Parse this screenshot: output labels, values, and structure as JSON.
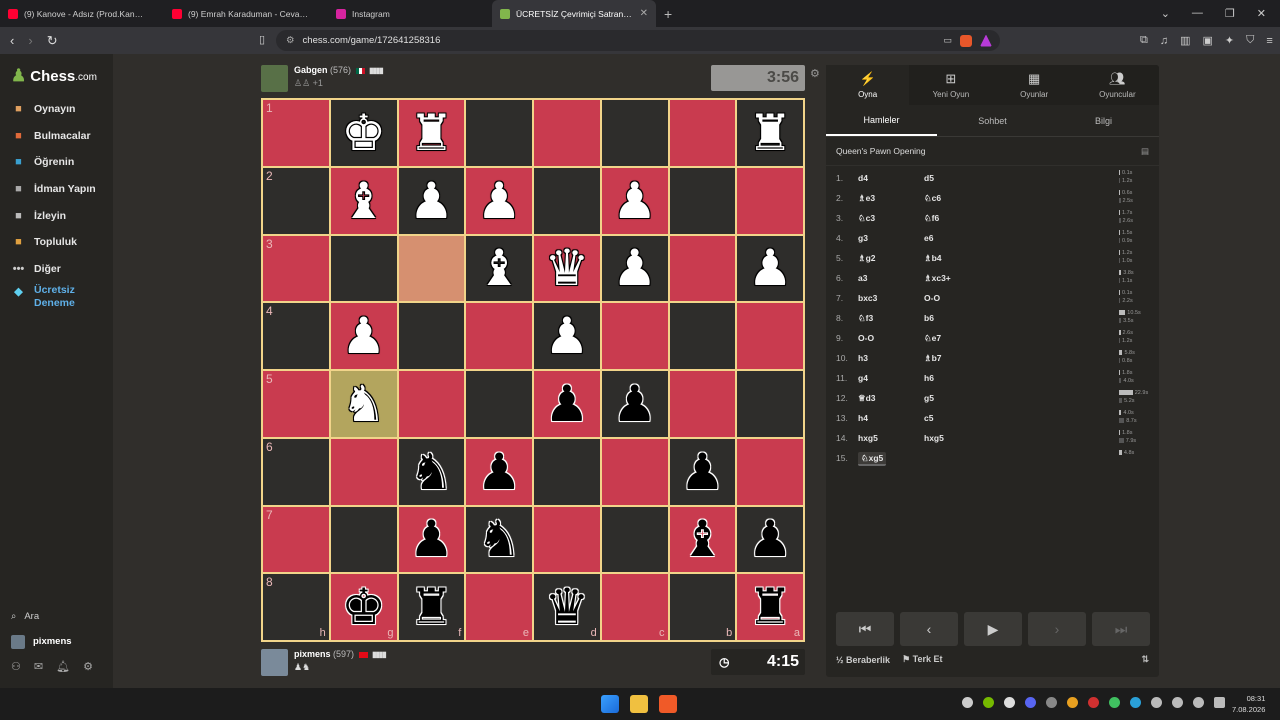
{
  "browser": {
    "tabs": [
      {
        "title": "(9) Kanove - Adsız (Prod.Kanove) - YouTube",
        "color": "#ff0033",
        "active": false
      },
      {
        "title": "(9) Emrah Karaduman - Cevapsız Çınlama",
        "color": "#ff0033",
        "active": false
      },
      {
        "title": "Instagram",
        "color": "#d6249f",
        "active": false
      },
      {
        "title": "ÜCRETSİZ Çevrimiçi Satranç Oyna",
        "color": "#81b64c",
        "active": true
      }
    ],
    "url": "chess.com/game/172641258316"
  },
  "sidebar": {
    "logo": "Chess",
    "logo_suffix": ".com",
    "items": [
      {
        "label": "Oynayın",
        "icon": "play-icon",
        "color": "#e0a060"
      },
      {
        "label": "Bulmacalar",
        "icon": "puzzle-icon",
        "color": "#e06a3a"
      },
      {
        "label": "Öğrenin",
        "icon": "learn-icon",
        "color": "#3aa0d0"
      },
      {
        "label": "İdman Yapın",
        "icon": "train-icon",
        "color": "#aaaaaa"
      },
      {
        "label": "İzleyin",
        "icon": "watch-icon",
        "color": "#bbbbbb"
      },
      {
        "label": "Topluluk",
        "icon": "community-icon",
        "color": "#e0a040"
      },
      {
        "label": "Diğer",
        "icon": "more-icon",
        "color": "#cccccc"
      }
    ],
    "trial_line1": "Ücretsiz",
    "trial_line2": "Deneme",
    "search": "Ara",
    "username": "pixmens"
  },
  "top_player": {
    "name": "Gabgen",
    "rating": "(576)",
    "captured_extra": "+1",
    "clock": "3:56"
  },
  "bottom_player": {
    "name": "pixmens",
    "rating": "(597)",
    "clock": "4:15"
  },
  "board": {
    "ranks": [
      "1",
      "2",
      "3",
      "4",
      "5",
      "6",
      "7",
      "8"
    ],
    "files": [
      "h",
      "g",
      "f",
      "e",
      "d",
      "c",
      "b",
      "a"
    ],
    "squares": [
      [
        "",
        "wK",
        "wR",
        "",
        "",
        "",
        "",
        "wR"
      ],
      [
        "",
        "wB",
        "wP",
        "wP",
        "",
        "wP",
        "",
        ""
      ],
      [
        "",
        "",
        "",
        "wB",
        "wQ",
        "wP",
        "",
        "wP"
      ],
      [
        "",
        "wP",
        "",
        "",
        "wP",
        "",
        "",
        ""
      ],
      [
        "",
        "wN",
        "",
        "",
        "bP",
        "bP",
        "",
        ""
      ],
      [
        "",
        "",
        "bN",
        "bP",
        "",
        "",
        "bP",
        ""
      ],
      [
        "",
        "",
        "bP",
        "bN",
        "",
        "",
        "bB",
        "bP"
      ],
      [
        "",
        "bK",
        "bR",
        "",
        "bQ",
        "",
        "",
        "bR"
      ]
    ]
  },
  "panel": {
    "tabs": [
      {
        "label": "Oyna",
        "icon": "bolt-icon"
      },
      {
        "label": "Yeni Oyun",
        "icon": "plus-icon"
      },
      {
        "label": "Oyunlar",
        "icon": "board-icon"
      },
      {
        "label": "Oyuncular",
        "icon": "players-icon"
      }
    ],
    "subtabs": [
      "Hamleler",
      "Sohbet",
      "Bilgi"
    ],
    "opening": "Queen's Pawn Opening",
    "moves": [
      {
        "n": "1.",
        "w": "d4",
        "b": "d5",
        "tw": "0.1s",
        "tb": "1.2s"
      },
      {
        "n": "2.",
        "w": "♗e3",
        "b": "♘c6",
        "tw": "0.6s",
        "tb": "2.5s"
      },
      {
        "n": "3.",
        "w": "♘c3",
        "b": "♘f6",
        "tw": "1.7s",
        "tb": "2.6s"
      },
      {
        "n": "4.",
        "w": "g3",
        "b": "e6",
        "tw": "1.5s",
        "tb": "0.9s"
      },
      {
        "n": "5.",
        "w": "♗g2",
        "b": "♗b4",
        "tw": "1.2s",
        "tb": "1.0s"
      },
      {
        "n": "6.",
        "w": "a3",
        "b": "♗xc3+",
        "tw": "3.8s",
        "tb": "1.1s"
      },
      {
        "n": "7.",
        "w": "bxc3",
        "b": "O-O",
        "tw": "0.1s",
        "tb": "2.2s"
      },
      {
        "n": "8.",
        "w": "♘f3",
        "b": "b6",
        "tw": "10.5s",
        "tb": "3.5s"
      },
      {
        "n": "9.",
        "w": "O-O",
        "b": "♘e7",
        "tw": "2.6s",
        "tb": "1.2s"
      },
      {
        "n": "10.",
        "w": "h3",
        "b": "♗b7",
        "tw": "5.8s",
        "tb": "0.8s"
      },
      {
        "n": "11.",
        "w": "g4",
        "b": "h6",
        "tw": "1.8s",
        "tb": "4.0s"
      },
      {
        "n": "12.",
        "w": "♕d3",
        "b": "g5",
        "tw": "22.9s",
        "tb": "5.2s"
      },
      {
        "n": "13.",
        "w": "h4",
        "b": "c5",
        "tw": "4.0s",
        "tb": "8.7s"
      },
      {
        "n": "14.",
        "w": "hxg5",
        "b": "hxg5",
        "tw": "1.8s",
        "tb": "7.9s"
      },
      {
        "n": "15.",
        "w": "♘xg5",
        "b": "",
        "tw": "4.8s",
        "tb": ""
      }
    ],
    "draw": "Beraberlik",
    "draw_prefix": "½",
    "resign": "Terk Et"
  },
  "taskbar": {
    "time": "08:31",
    "date": "7.08.2026"
  }
}
